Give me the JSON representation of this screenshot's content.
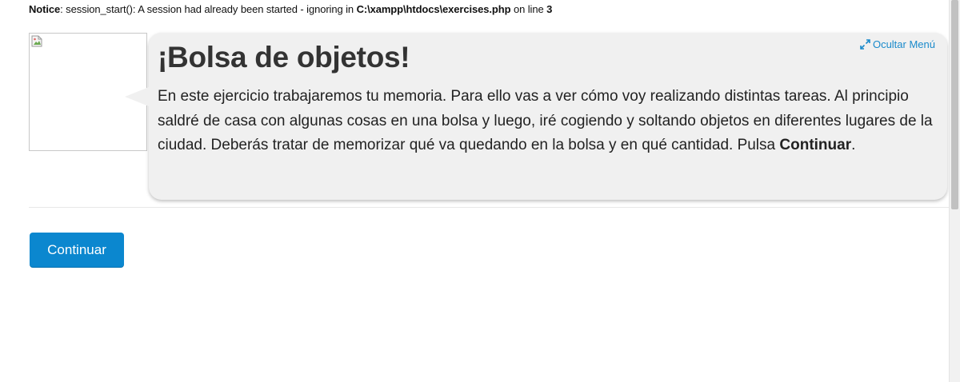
{
  "notice": {
    "label": "Notice",
    "message": ": session_start(): A session had already been started - ignoring in ",
    "file": "C:\\xampp\\htdocs\\exercises.php",
    "line_text": " on line ",
    "line_number": "3"
  },
  "exercise": {
    "hide_menu_label": "Ocultar Menú",
    "title": "¡Bolsa de objetos!",
    "description": "En este ejercicio trabajaremos tu memoria. Para ello vas a ver cómo voy realizando distintas tareas. Al principio saldré de casa con algunas cosas en una bolsa y luego, iré cogiendo y soltando objetos en diferentes lugares de la ciudad. Deberás tratar de memorizar qué va quedando en la bolsa y en qué cantidad. Pulsa ",
    "description_bold": "Continuar",
    "description_end": "."
  },
  "actions": {
    "continue_label": "Continuar"
  },
  "icons": {
    "hide_menu": "expand-arrows-icon",
    "avatar": "broken-image-icon"
  },
  "colors": {
    "accent": "#0b87cf",
    "link": "#1a8acb",
    "bubble": "#f0f0f0"
  }
}
